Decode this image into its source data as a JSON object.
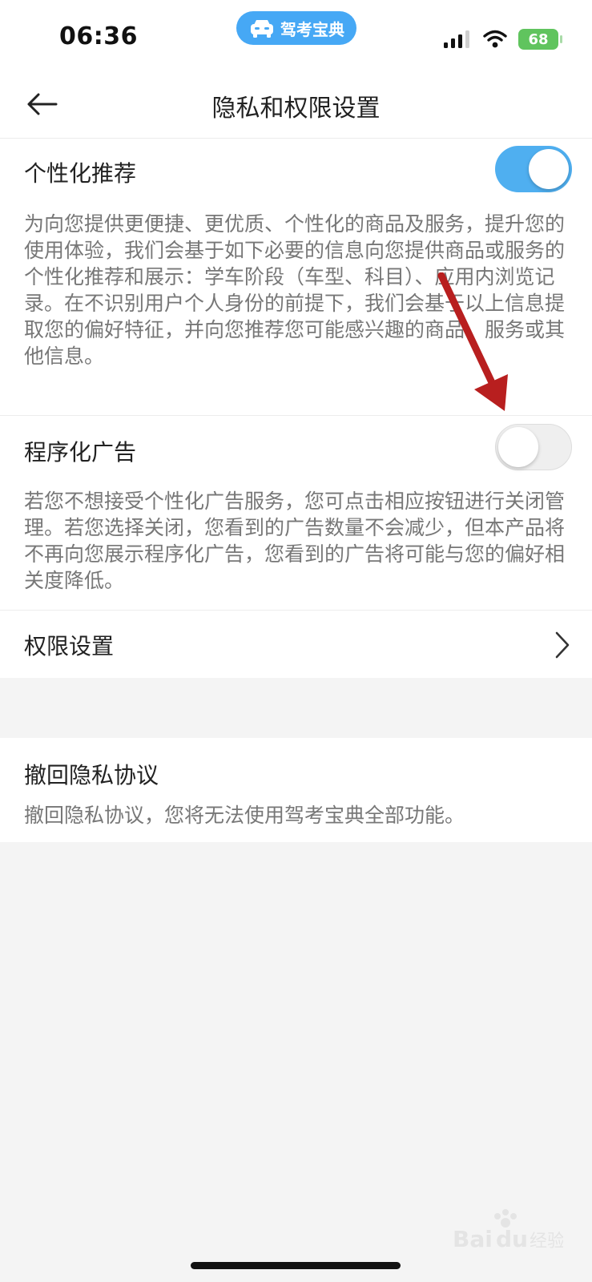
{
  "status_bar": {
    "time": "06:36",
    "app_badge": "驾考宝典",
    "battery": "68"
  },
  "header": {
    "back_icon": "back-arrow-icon",
    "title": "隐私和权限设置"
  },
  "sections": {
    "personalized": {
      "title": "个性化推荐",
      "enabled": true,
      "description": "为向您提供更便捷、更优质、个性化的商品及服务，提升您的使用体验，我们会基于如下必要的信息向您提供商品或服务的个性化推荐和展示：学车阶段（车型、科目）、应用内浏览记录。在不识别用户个人身份的前提下，我们会基于以上信息提取您的偏好特征，并向您推荐您可能感兴趣的商品、服务或其他信息。"
    },
    "programmatic_ads": {
      "title": "程序化广告",
      "enabled": false,
      "description": "若您不想接受个性化广告服务，您可点击相应按钮进行关闭管理。若您选择关闭，您看到的广告数量不会减少，但本产品将不再向您展示程序化广告，您看到的广告将可能与您的偏好相关度降低。"
    },
    "permissions": {
      "title": "权限设置"
    },
    "revoke": {
      "title": "撤回隐私协议",
      "description": "撤回隐私协议，您将无法使用驾考宝典全部功能。"
    }
  },
  "colors": {
    "accent": "#4faff0",
    "annotation_arrow": "#b81f1f"
  },
  "watermark_text": "Baidu经验"
}
